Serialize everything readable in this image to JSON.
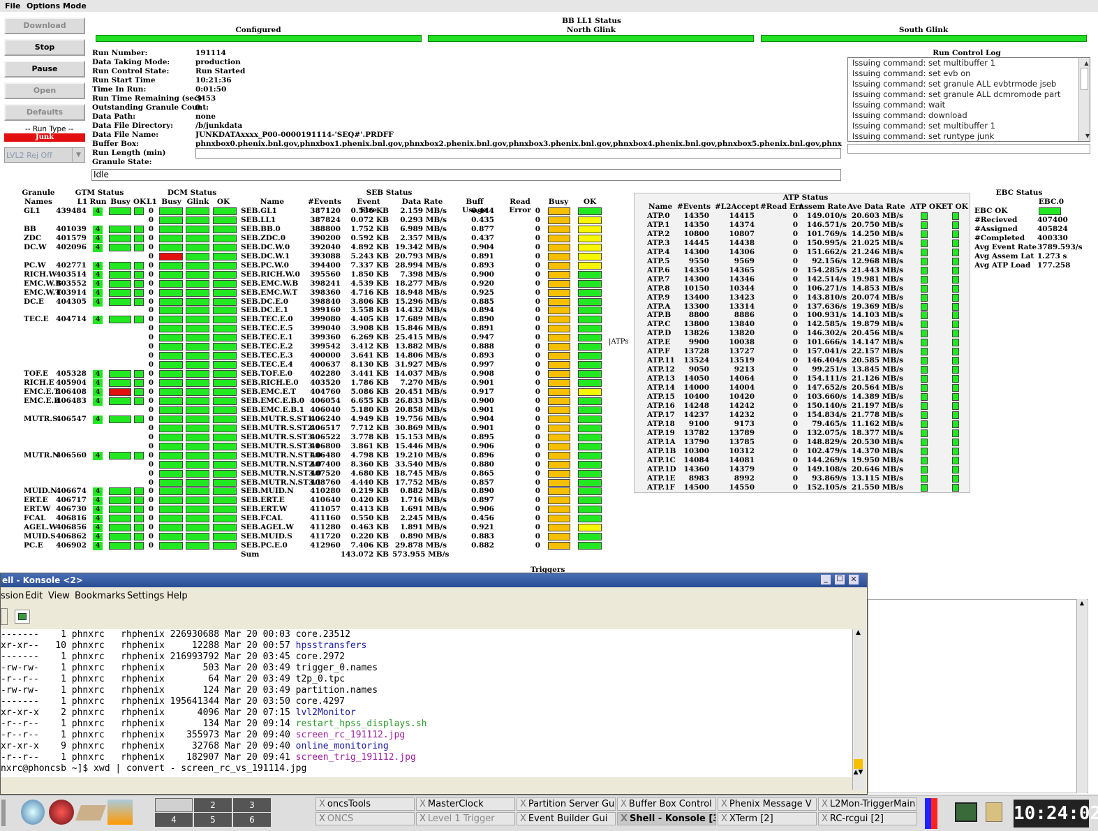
{
  "menu": [
    "File",
    "Options",
    "Mode"
  ],
  "buttons": [
    {
      "label": "Download",
      "enabled": false
    },
    {
      "label": "Stop",
      "enabled": true
    },
    {
      "label": "Pause",
      "enabled": true
    },
    {
      "label": "Open",
      "enabled": false
    },
    {
      "label": "Defaults",
      "enabled": false
    }
  ],
  "run_type": {
    "title": "-- Run Type --",
    "value": "Junk",
    "lvl2": "LVL2 Rej Off"
  },
  "top_status": {
    "configured": "Configured",
    "bbll1": "BB LL1 Status",
    "north": "North Glink",
    "south": "South Glink"
  },
  "run_info": [
    [
      "Run Number:",
      "191114"
    ],
    [
      "Data Taking Mode:",
      "production"
    ],
    [
      "Run Control State:",
      "Run Started"
    ],
    [
      "Run Start Time",
      "10:21:36"
    ],
    [
      "Time In Run:",
      "0:01:50"
    ],
    [
      "Run Time Remaining (sec)",
      "3453"
    ],
    [
      "Outstanding Granule Count:",
      "0"
    ],
    [
      "Data Path:",
      "none"
    ],
    [
      "Data File Directory:",
      "/b/junkdata"
    ],
    [
      "Data File Name:",
      "JUNKDATAxxxx_P00-0000191114-'SEQ#'.PRDFF"
    ],
    [
      "Buffer Box:",
      "phnxbox0.phenix.bnl.gov,phnxbox1.phenix.bnl.gov,phnxbox2.phenix.bnl.gov,phnxbox3.phenix.bnl.gov,phnxbox4.phenix.bnl.gov,phnxbox5.phenix.bnl.gov,phnxbox6.phenix.bnl.gov"
    ],
    [
      "Run Length (min)",
      ""
    ],
    [
      "Granule State:",
      ""
    ]
  ],
  "granule_state_value": "Idle",
  "log": {
    "title": "Run Control Log",
    "lines": [
      "Issuing command: set multibuffer 1",
      "Issuing command: set evb on",
      "Issuing command: set granule ALL evbtrmode jseb",
      "Issuing command: set granule ALL dcmromode part",
      "Issuing command: wait",
      "Issuing command: download",
      "Issuing command: set multibuffer 1",
      "Issuing command: set runtype junk"
    ]
  },
  "headers": {
    "granule": "Granule",
    "names": "Names",
    "gtm": "GTM Status",
    "l1": "L1",
    "run": "Run",
    "busy": "Busy",
    "ok": "OK",
    "dcm": "DCM Status",
    "glink": "Glink",
    "seb": "SEB Status",
    "name": "Name",
    "events": "#Events",
    "evsize": "Event Size",
    "rate": "Data Rate",
    "buff": "Buff Usage",
    "rerr": "Read Error",
    "atp": "ATP Status",
    "ebc": "EBC Status",
    "atps": "ATPs",
    "triggers": "Triggers"
  },
  "granules": [
    {
      "name": "GL1",
      "l1": "439484",
      "row": 0,
      "dcm": "g"
    },
    {
      "name": "BB",
      "l1": "401039",
      "row": 2,
      "dcm": "g"
    },
    {
      "name": "ZDC",
      "l1": "401579",
      "row": 3,
      "dcm": "g"
    },
    {
      "name": "DC.W",
      "l1": "402096",
      "row": 4,
      "dcm": "g"
    },
    {
      "name": "PC.W",
      "l1": "402771",
      "row": 6,
      "dcm": "g"
    },
    {
      "name": "RICH.W",
      "l1": "403514",
      "row": 7,
      "dcm": "g"
    },
    {
      "name": "EMC.W.B",
      "l1": "403552",
      "row": 8,
      "dcm": "g"
    },
    {
      "name": "EMC.W.T",
      "l1": "403914",
      "row": 9,
      "dcm": "g"
    },
    {
      "name": "DC.E",
      "l1": "404305",
      "row": 10,
      "dcm": "g"
    },
    {
      "name": "TEC.E",
      "l1": "404714",
      "row": 12,
      "dcm": "g"
    },
    {
      "name": "TOF.E",
      "l1": "405328",
      "row": 18,
      "dcm": "g"
    },
    {
      "name": "RICH.E",
      "l1": "405904",
      "row": 19,
      "dcm": "g"
    },
    {
      "name": "EMC.E.T",
      "l1": "406408",
      "row": 20,
      "dcm": "r"
    },
    {
      "name": "EMC.E.B",
      "l1": "406483",
      "row": 21,
      "dcm": "g"
    },
    {
      "name": "MUTR.S",
      "l1": "406547",
      "row": 23,
      "dcm": "g"
    },
    {
      "name": "MUTR.N",
      "l1": "406560",
      "row": 27,
      "dcm": "g"
    },
    {
      "name": "MUID.N",
      "l1": "406674",
      "row": 31,
      "dcm": "g"
    },
    {
      "name": "ERT.E",
      "l1": "406717",
      "row": 32,
      "dcm": "g"
    },
    {
      "name": "ERT.W",
      "l1": "406730",
      "row": 33,
      "dcm": "g"
    },
    {
      "name": "FCAL",
      "l1": "406816",
      "row": 34,
      "dcm": "g"
    },
    {
      "name": "AGEL.W",
      "l1": "406856",
      "row": 35,
      "dcm": "g"
    },
    {
      "name": "MUID.S",
      "l1": "406862",
      "row": 36,
      "dcm": "g"
    },
    {
      "name": "PC.E",
      "l1": "406902",
      "row": 37,
      "dcm": "g"
    }
  ],
  "gtm_run": "4",
  "seb": [
    [
      "SEB.GL1",
      "387120",
      "0.536 KB",
      "2.159 MB/s",
      "0.444",
      "0",
      "g",
      "g"
    ],
    [
      "SEB.LL1",
      "387824",
      "0.072 KB",
      "0.293 MB/s",
      "0.435",
      "0",
      "g",
      "y"
    ],
    [
      "SEB.BB.0",
      "388800",
      "1.752 KB",
      "6.989 MB/s",
      "0.877",
      "0",
      "g",
      "y"
    ],
    [
      "SEB.ZDC.0",
      "390200",
      "0.592 KB",
      "2.357 MB/s",
      "0.437",
      "0",
      "g",
      "y"
    ],
    [
      "SEB.DC.W.0",
      "392040",
      "4.892 KB",
      "19.342 MB/s",
      "0.904",
      "0",
      "g",
      "y"
    ],
    [
      "SEB.DC.W.1",
      "393088",
      "5.243 KB",
      "20.793 MB/s",
      "0.891",
      "0",
      "r",
      "y"
    ],
    [
      "SEB.PC.W.0",
      "394400",
      "7.337 KB",
      "28.994 MB/s",
      "0.893",
      "0",
      "g",
      "y"
    ],
    [
      "SEB.RICH.W.0",
      "395560",
      "1.850 KB",
      "7.398 MB/s",
      "0.900",
      "0",
      "g",
      "g"
    ],
    [
      "SEB.EMC.W.B",
      "398241",
      "4.539 KB",
      "18.277 MB/s",
      "0.920",
      "0",
      "g",
      "g"
    ],
    [
      "SEB.EMC.W.T",
      "398360",
      "4.716 KB",
      "18.948 MB/s",
      "0.925",
      "0",
      "g",
      "g"
    ],
    [
      "SEB.DC.E.0",
      "398840",
      "3.806 KB",
      "15.296 MB/s",
      "0.885",
      "0",
      "g",
      "g"
    ],
    [
      "SEB.DC.E.1",
      "399160",
      "3.558 KB",
      "14.432 MB/s",
      "0.894",
      "0",
      "g",
      "g"
    ],
    [
      "SEB.TEC.E.0",
      "399080",
      "4.405 KB",
      "17.689 MB/s",
      "0.890",
      "0",
      "g",
      "g"
    ],
    [
      "SEB.TEC.E.5",
      "399040",
      "3.908 KB",
      "15.846 MB/s",
      "0.891",
      "0",
      "g",
      "g"
    ],
    [
      "SEB.TEC.E.1",
      "399360",
      "6.269 KB",
      "25.415 MB/s",
      "0.947",
      "0",
      "g",
      "g"
    ],
    [
      "SEB.TEC.E.2",
      "399542",
      "3.412 KB",
      "13.882 MB/s",
      "0.888",
      "0",
      "g",
      "g"
    ],
    [
      "SEB.TEC.E.3",
      "400000",
      "3.641 KB",
      "14.806 MB/s",
      "0.893",
      "0",
      "g",
      "g"
    ],
    [
      "SEB.TEC.E.4",
      "400637",
      "8.130 KB",
      "31.927 MB/s",
      "0.997",
      "0",
      "g",
      "g"
    ],
    [
      "SEB.TOF.E.0",
      "402280",
      "3.441 KB",
      "14.037 MB/s",
      "0.908",
      "0",
      "g",
      "g"
    ],
    [
      "SEB.RICH.E.0",
      "403520",
      "1.786 KB",
      "7.270 MB/s",
      "0.901",
      "0",
      "g",
      "g"
    ],
    [
      "SEB.EMC.E.T",
      "404760",
      "5.086 KB",
      "20.451 MB/s",
      "0.917",
      "0",
      "g",
      "y"
    ],
    [
      "SEB.EMC.E.B.0",
      "406054",
      "6.655 KB",
      "26.833 MB/s",
      "0.900",
      "0",
      "g",
      "g"
    ],
    [
      "SEB.EMC.E.B.1",
      "406040",
      "5.180 KB",
      "20.858 MB/s",
      "0.901",
      "0",
      "g",
      "g"
    ],
    [
      "SEB.MUTR.S.ST1.0",
      "406240",
      "4.949 KB",
      "19.756 MB/s",
      "0.904",
      "0",
      "g",
      "g"
    ],
    [
      "SEB.MUTR.S.ST2.0",
      "406517",
      "7.712 KB",
      "30.869 MB/s",
      "0.901",
      "0",
      "g",
      "g"
    ],
    [
      "SEB.MUTR.S.ST3.0",
      "406522",
      "3.778 KB",
      "15.153 MB/s",
      "0.895",
      "0",
      "g",
      "g"
    ],
    [
      "SEB.MUTR.S.ST3.1",
      "406800",
      "3.861 KB",
      "15.446 MB/s",
      "0.906",
      "0",
      "g",
      "g"
    ],
    [
      "SEB.MUTR.N.ST1.0",
      "406480",
      "4.798 KB",
      "19.210 MB/s",
      "0.896",
      "0",
      "g",
      "g"
    ],
    [
      "SEB.MUTR.N.ST2.0",
      "407400",
      "8.360 KB",
      "33.540 MB/s",
      "0.880",
      "0",
      "g",
      "g"
    ],
    [
      "SEB.MUTR.N.ST3.0",
      "407520",
      "4.680 KB",
      "18.745 MB/s",
      "0.865",
      "0",
      "g",
      "g"
    ],
    [
      "SEB.MUTR.N.ST3.1",
      "408760",
      "4.440 KB",
      "17.752 MB/s",
      "0.857",
      "0",
      "g",
      "g"
    ],
    [
      "SEB.MUID.N",
      "410280",
      "0.219 KB",
      "0.882 MB/s",
      "0.890",
      "0",
      "g",
      "g"
    ],
    [
      "SEB.ERT.E",
      "410640",
      "0.420 KB",
      "1.716 MB/s",
      "0.897",
      "0",
      "g",
      "g"
    ],
    [
      "SEB.ERT.W",
      "411057",
      "0.413 KB",
      "1.691 MB/s",
      "0.906",
      "0",
      "g",
      "g"
    ],
    [
      "SEB.FCAL",
      "411160",
      "0.550 KB",
      "2.245 MB/s",
      "0.456",
      "0",
      "g",
      "g"
    ],
    [
      "SEB.AGEL.W",
      "411280",
      "0.463 KB",
      "1.891 MB/s",
      "0.921",
      "0",
      "g",
      "y"
    ],
    [
      "SEB.MUID.S",
      "411720",
      "0.220 KB",
      "0.890 MB/s",
      "0.883",
      "0",
      "g",
      "g"
    ],
    [
      "SEB.PC.E.0",
      "412960",
      "7.406 KB",
      "29.878 MB/s",
      "0.882",
      "0",
      "g",
      "g"
    ]
  ],
  "seb_sum": {
    "label": "Sum",
    "size": "143.072 KB",
    "rate": "573.955 MB/s"
  },
  "atp_headers": [
    "Name",
    "#Events",
    "#L2Accept",
    "#Read Err",
    "Assem Rate",
    "Ave Data Rate",
    "ATP OK",
    "ET OK"
  ],
  "atp": [
    [
      "ATP.0",
      "14350",
      "14415",
      "0",
      "149.010/s",
      "20.603 MB/s"
    ],
    [
      "ATP.1",
      "14350",
      "14374",
      "0",
      "146.571/s",
      "20.750 MB/s"
    ],
    [
      "ATP.2",
      "10800",
      "10807",
      "0",
      "101.769/s",
      "14.250 MB/s"
    ],
    [
      "ATP.3",
      "14445",
      "14438",
      "0",
      "150.995/s",
      "21.025 MB/s"
    ],
    [
      "ATP.4",
      "14300",
      "14306",
      "0",
      "151.662/s",
      "21.246 MB/s"
    ],
    [
      "ATP.5",
      "9550",
      "9569",
      "0",
      "92.156/s",
      "12.968 MB/s"
    ],
    [
      "ATP.6",
      "14350",
      "14365",
      "0",
      "154.285/s",
      "21.443 MB/s"
    ],
    [
      "ATP.7",
      "14300",
      "14346",
      "0",
      "142.514/s",
      "19.981 MB/s"
    ],
    [
      "ATP.8",
      "10150",
      "10344",
      "0",
      "106.271/s",
      "14.853 MB/s"
    ],
    [
      "ATP.9",
      "13400",
      "13423",
      "0",
      "143.810/s",
      "20.074 MB/s"
    ],
    [
      "ATP.A",
      "13300",
      "13314",
      "0",
      "137.636/s",
      "19.369 MB/s"
    ],
    [
      "ATP.B",
      "8800",
      "8886",
      "0",
      "100.931/s",
      "14.103 MB/s"
    ],
    [
      "ATP.C",
      "13800",
      "13840",
      "0",
      "142.585/s",
      "19.879 MB/s"
    ],
    [
      "ATP.D",
      "13826",
      "13820",
      "0",
      "146.302/s",
      "20.456 MB/s"
    ],
    [
      "ATP.E",
      "9900",
      "10038",
      "0",
      "101.666/s",
      "14.147 MB/s"
    ],
    [
      "ATP.F",
      "13728",
      "13727",
      "0",
      "157.041/s",
      "22.157 MB/s"
    ],
    [
      "ATP.11",
      "13524",
      "13519",
      "0",
      "146.404/s",
      "20.585 MB/s"
    ],
    [
      "ATP.12",
      "9050",
      "9213",
      "0",
      "99.251/s",
      "13.845 MB/s"
    ],
    [
      "ATP.13",
      "14050",
      "14064",
      "0",
      "154.111/s",
      "21.126 MB/s"
    ],
    [
      "ATP.14",
      "14000",
      "14004",
      "0",
      "147.652/s",
      "20.564 MB/s"
    ],
    [
      "ATP.15",
      "10400",
      "10420",
      "0",
      "103.660/s",
      "14.389 MB/s"
    ],
    [
      "ATP.16",
      "14248",
      "14242",
      "0",
      "150.140/s",
      "21.197 MB/s"
    ],
    [
      "ATP.17",
      "14237",
      "14232",
      "0",
      "154.834/s",
      "21.778 MB/s"
    ],
    [
      "ATP.18",
      "9100",
      "9173",
      "0",
      "79.465/s",
      "11.162 MB/s"
    ],
    [
      "ATP.19",
      "13782",
      "13789",
      "0",
      "132.075/s",
      "18.377 MB/s"
    ],
    [
      "ATP.1A",
      "13790",
      "13785",
      "0",
      "148.829/s",
      "20.530 MB/s"
    ],
    [
      "ATP.1B",
      "10300",
      "10312",
      "0",
      "102.479/s",
      "14.370 MB/s"
    ],
    [
      "ATP.1C",
      "14084",
      "14081",
      "0",
      "144.269/s",
      "19.950 MB/s"
    ],
    [
      "ATP.1D",
      "14360",
      "14379",
      "0",
      "149.108/s",
      "20.646 MB/s"
    ],
    [
      "ATP.1E",
      "8983",
      "8992",
      "0",
      "93.869/s",
      "13.115 MB/s"
    ],
    [
      "ATP.1F",
      "14500",
      "14550",
      "0",
      "152.105/s",
      "21.550 MB/s"
    ]
  ],
  "ebc": {
    "col": "EBC.0",
    "rows": [
      [
        "EBC OK",
        ""
      ],
      [
        "#Recieved",
        "407400"
      ],
      [
        "#Assigned",
        "405824"
      ],
      [
        "#Completed",
        "400330"
      ],
      [
        "Avg Event Rate",
        "3789.593/s"
      ],
      [
        "Avg Assem Lat",
        "1.273 s"
      ],
      [
        "Avg ATP Load",
        "177.258"
      ]
    ]
  },
  "konsole": {
    "title": "ell - Konsole <2>",
    "menu": [
      "ssion",
      "Edit",
      "View",
      "Bookmarks",
      "Settings",
      "Help"
    ],
    "lines": [
      [
        "-------    1 phnxrc   rhphenix 226930688 Mar 20 00:03 ",
        "core.23512",
        ""
      ],
      [
        "xr-xr--   10 phnxrc   rhphenix     12288 Mar 20 00:57 ",
        "hpsstransfers",
        "dir"
      ],
      [
        "-------    1 phnxrc   rhphenix 216993792 Mar 20 03:45 ",
        "core.2972",
        ""
      ],
      [
        "-rw-rw-    1 phnxrc   rhphenix       503 Mar 20 03:49 ",
        "trigger_0.names",
        ""
      ],
      [
        "-r--r--    1 phnxrc   rhphenix        64 Mar 20 03:49 ",
        "t2p_0.tpc",
        ""
      ],
      [
        "-rw-rw-    1 phnxrc   rhphenix       124 Mar 20 03:49 ",
        "partition.names",
        ""
      ],
      [
        "-------    1 phnxrc   rhphenix 195641344 Mar 20 03:50 ",
        "core.4297",
        ""
      ],
      [
        "xr-xr-x    2 phnxrc   rhphenix      4096 Mar 20 07:15 ",
        "lvl2Monitor",
        "dir"
      ],
      [
        "-r--r--    1 phnxrc   rhphenix       134 Mar 20 09:14 ",
        "restart_hpss_displays.sh",
        "exe"
      ],
      [
        "-r--r--    1 phnxrc   rhphenix    355973 Mar 20 09:40 ",
        "screen_rc_191112.jpg",
        "img"
      ],
      [
        "xr-xr-x    9 phnxrc   rhphenix     32768 Mar 20 09:40 ",
        "online_monitoring",
        "dir"
      ],
      [
        "-r--r--    1 phnxrc   rhphenix    182907 Mar 20 09:41 ",
        "screen_trig_191112.jpg",
        "img"
      ],
      [
        "nxrc@phoncsb ~]$ xwd | convert - screen_rc_vs_191114.jpg",
        "",
        ""
      ]
    ]
  },
  "taskbar": {
    "pages": [
      "2",
      "3",
      "4",
      "5",
      "6"
    ],
    "tasks_top": [
      "oncsTools",
      "MasterClock",
      "Partition Server Gui",
      "Buffer Box Control",
      "Phenix Message V",
      "L2Mon-TriggerMain"
    ],
    "tasks_bottom": [
      "ONCS",
      "Level 1 Trigger",
      "Event Builder Gui",
      "Shell - Konsole [3]",
      "XTerm [2]",
      "RC-rcgui [2]"
    ],
    "clock": "10:24:02"
  },
  "colors": {
    "green": "#22e822",
    "red": "#e21010",
    "yellow": "#f7f700",
    "orange": "#f6c000",
    "dir": "#1a1aa0",
    "exe": "#2a9a2a",
    "img": "#a020a0"
  }
}
